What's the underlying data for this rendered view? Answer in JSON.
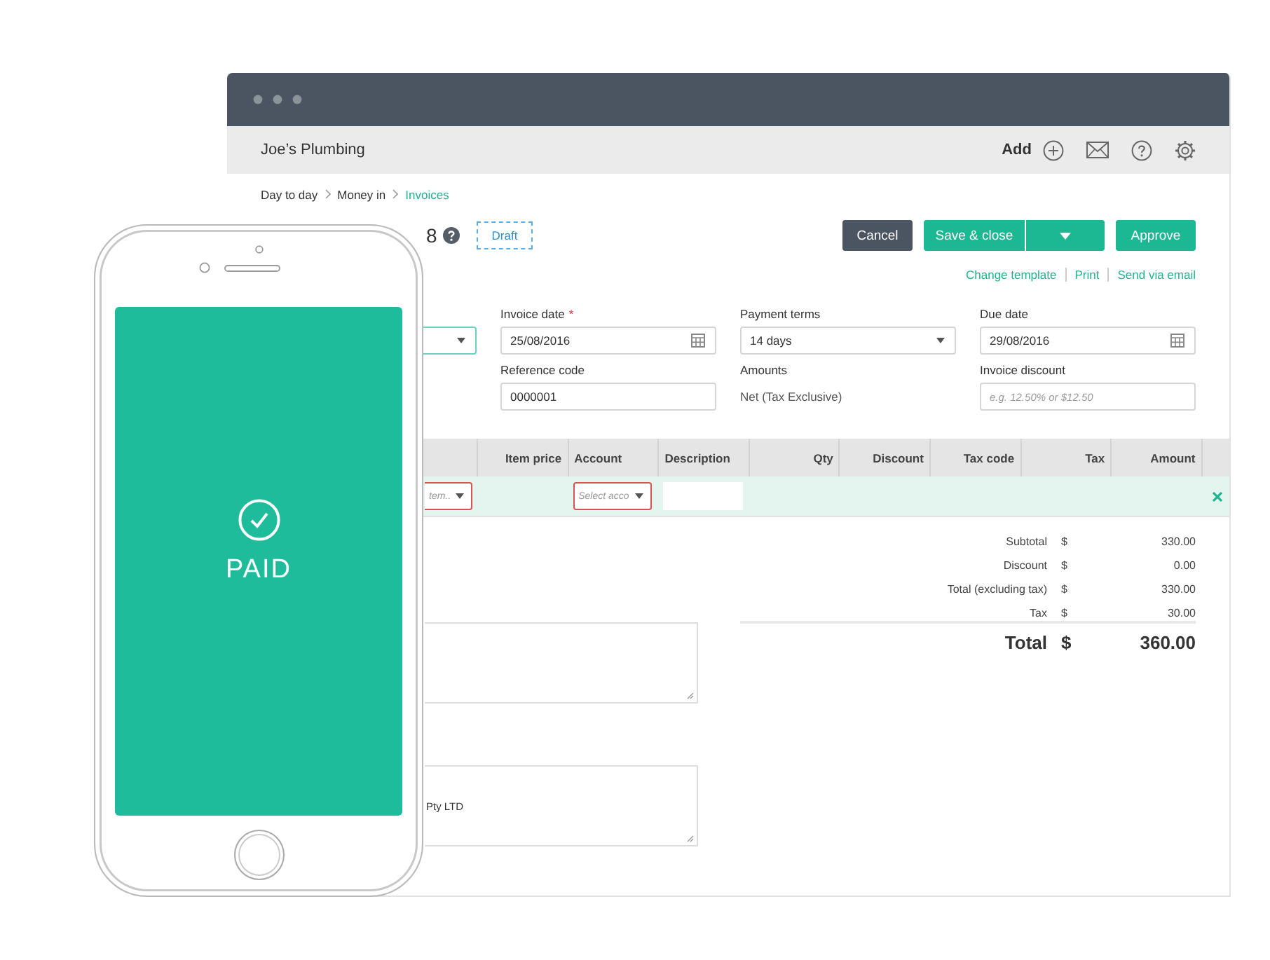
{
  "app_header": {
    "company": "Joe’s Plumbing",
    "add_label": "Add"
  },
  "breadcrumb": [
    {
      "label": "Day to day",
      "current": false
    },
    {
      "label": "Money in",
      "current": false
    },
    {
      "label": "Invoices",
      "current": true
    }
  ],
  "invoice": {
    "number": "8",
    "status": "Draft"
  },
  "buttons": [
    {
      "label": "Cancel",
      "kind": "secondary"
    },
    {
      "label": "Save & close",
      "kind": "split"
    },
    {
      "label": "Approve",
      "kind": "primary"
    }
  ],
  "links": [
    "Change template",
    "Print",
    "Send via email"
  ],
  "fields": [
    [
      {
        "kind": "select",
        "focused": true
      },
      {
        "kind": "date",
        "label": "Invoice date",
        "required_mark": "*",
        "value": "25/08/2016",
        "focused": false
      },
      {
        "kind": "select",
        "label": "Payment terms",
        "value": "14 days",
        "focused": false
      },
      {
        "kind": "date",
        "label": "Due date",
        "value": "29/08/2016",
        "focused": false
      }
    ],
    [
      {
        "kind": "text",
        "label": "Reference code",
        "value": "0000001",
        "focused": false
      },
      {
        "kind": "static",
        "label": "Amounts",
        "value": "Net (Tax Exclusive)"
      },
      {
        "kind": "text",
        "label": "Invoice discount",
        "placeholder": "e.g. 12.50% or $12.50",
        "focused": false
      }
    ]
  ],
  "table": {
    "columns": [
      {
        "label": "Item price"
      },
      {
        "label": "Account"
      },
      {
        "label": "Description"
      },
      {
        "label": "Qty"
      },
      {
        "label": "Discount"
      },
      {
        "label": "Tax code"
      },
      {
        "label": "Tax"
      },
      {
        "label": "Amount"
      }
    ],
    "rows": [
      {
        "editing": true,
        "item": {
          "placeholder": "tem..",
          "invalid": true
        },
        "account": {
          "placeholder": "Select acco",
          "invalid": true
        }
      }
    ]
  },
  "totals": [
    {
      "label": "Subtotal",
      "currency": "$",
      "amount": "330.00"
    },
    {
      "label": "Discount",
      "currency": "$",
      "amount": "0.00"
    },
    {
      "label": "Total (excluding tax)",
      "currency": "$",
      "amount": "330.00"
    },
    {
      "label": "Tax",
      "currency": "$",
      "amount": "30.00"
    }
  ],
  "grand_total": {
    "label": "Total",
    "currency": "$",
    "amount": "360.00"
  },
  "notes": [
    {
      "resizable": true
    },
    {
      "resizable": true,
      "value": "Pty LTD"
    }
  ],
  "phone": {
    "status": "PAID"
  }
}
